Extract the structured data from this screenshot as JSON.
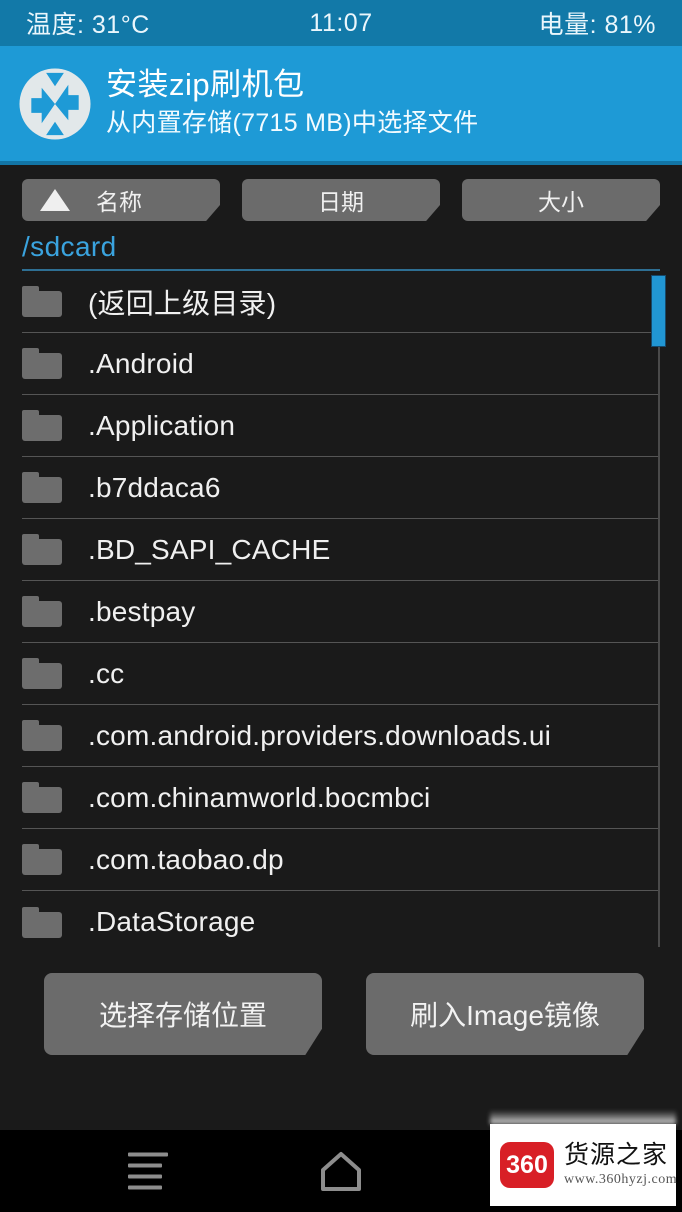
{
  "colors": {
    "statusbar_bg": "#1279a8",
    "header_bg": "#1e9ad6",
    "accent_blue": "#3aa3de",
    "scrollbar": "#2196d3",
    "button_gray": "#6b6b6b",
    "body_bg": "#1a1a1a",
    "watermark_red": "#d81f26"
  },
  "statusbar": {
    "temperature": "温度: 31°C",
    "clock": "11:07",
    "battery": "电量: 81%"
  },
  "header": {
    "logo_icon": "twrp-logo-icon",
    "title": "安装zip刷机包",
    "subtitle": "从内置存储(7715 MB)中选择文件"
  },
  "sort": {
    "ascending_icon": "triangle-up-icon",
    "buttons": [
      {
        "label": "名称",
        "active": true
      },
      {
        "label": "日期",
        "active": false
      },
      {
        "label": "大小",
        "active": false
      }
    ]
  },
  "path": {
    "current": "/sdcard"
  },
  "file_list": {
    "folder_icon": "folder-icon",
    "items": [
      {
        "name": "(返回上级目录)",
        "type": "folder"
      },
      {
        "name": ".Android",
        "type": "folder"
      },
      {
        "name": ".Application",
        "type": "folder"
      },
      {
        "name": ".b7ddaca6",
        "type": "folder"
      },
      {
        "name": ".BD_SAPI_CACHE",
        "type": "folder"
      },
      {
        "name": ".bestpay",
        "type": "folder"
      },
      {
        "name": ".cc",
        "type": "folder"
      },
      {
        "name": ".com.android.providers.downloads.ui",
        "type": "folder"
      },
      {
        "name": ".com.chinamworld.bocmbci",
        "type": "folder"
      },
      {
        "name": ".com.taobao.dp",
        "type": "folder"
      },
      {
        "name": ".DataStorage",
        "type": "folder"
      }
    ]
  },
  "actions": {
    "select_storage": "选择存储位置",
    "flash_image": "刷入Image镜像"
  },
  "navbar": {
    "menu_icon": "menu-icon",
    "home_icon": "home-icon"
  },
  "watermark": {
    "logo_text": "360",
    "name": "货源之家",
    "url": "www.360hyzj.com"
  }
}
